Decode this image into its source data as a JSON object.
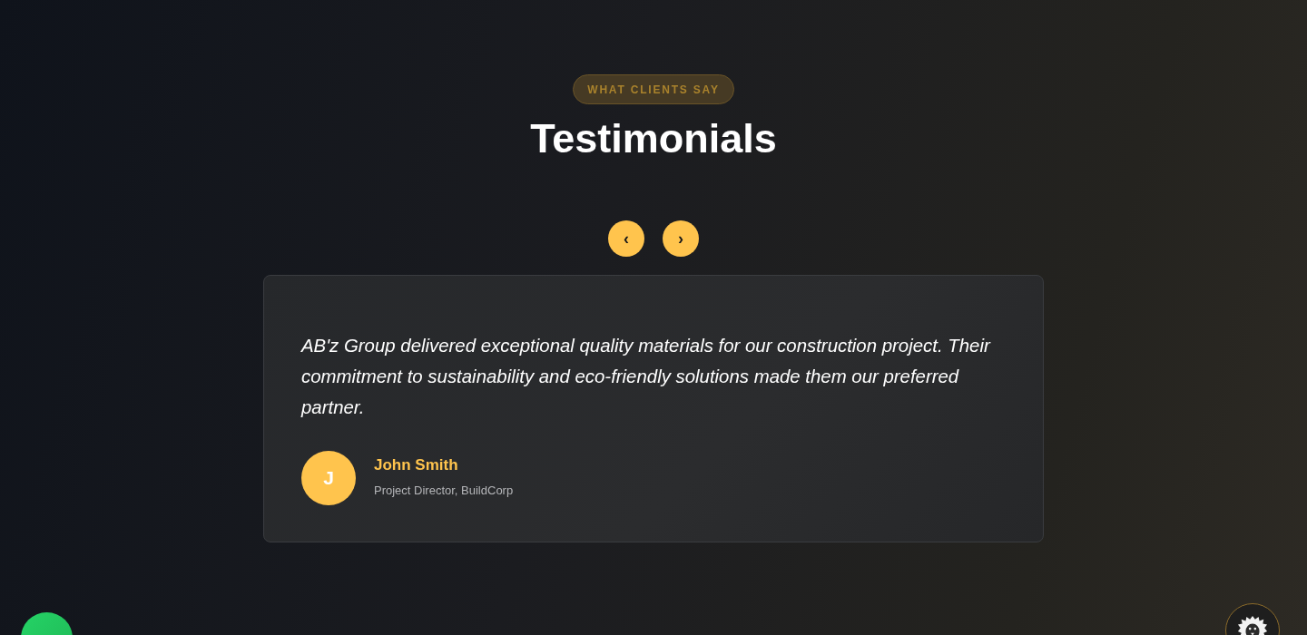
{
  "section": {
    "badge": "WHAT CLIENTS SAY",
    "title": "Testimonials"
  },
  "carousel_arrows": [
    {
      "label": "‹"
    },
    {
      "label": "›"
    }
  ],
  "testimonial": {
    "quote": "AB'z Group delivered exceptional quality materials for our construction project. Their commitment to sustainability and eco-friendly solutions made them our preferred partner.",
    "author": {
      "initial": "J",
      "name": "John Smith",
      "role": "Project Director, BuildCorp"
    }
  }
}
